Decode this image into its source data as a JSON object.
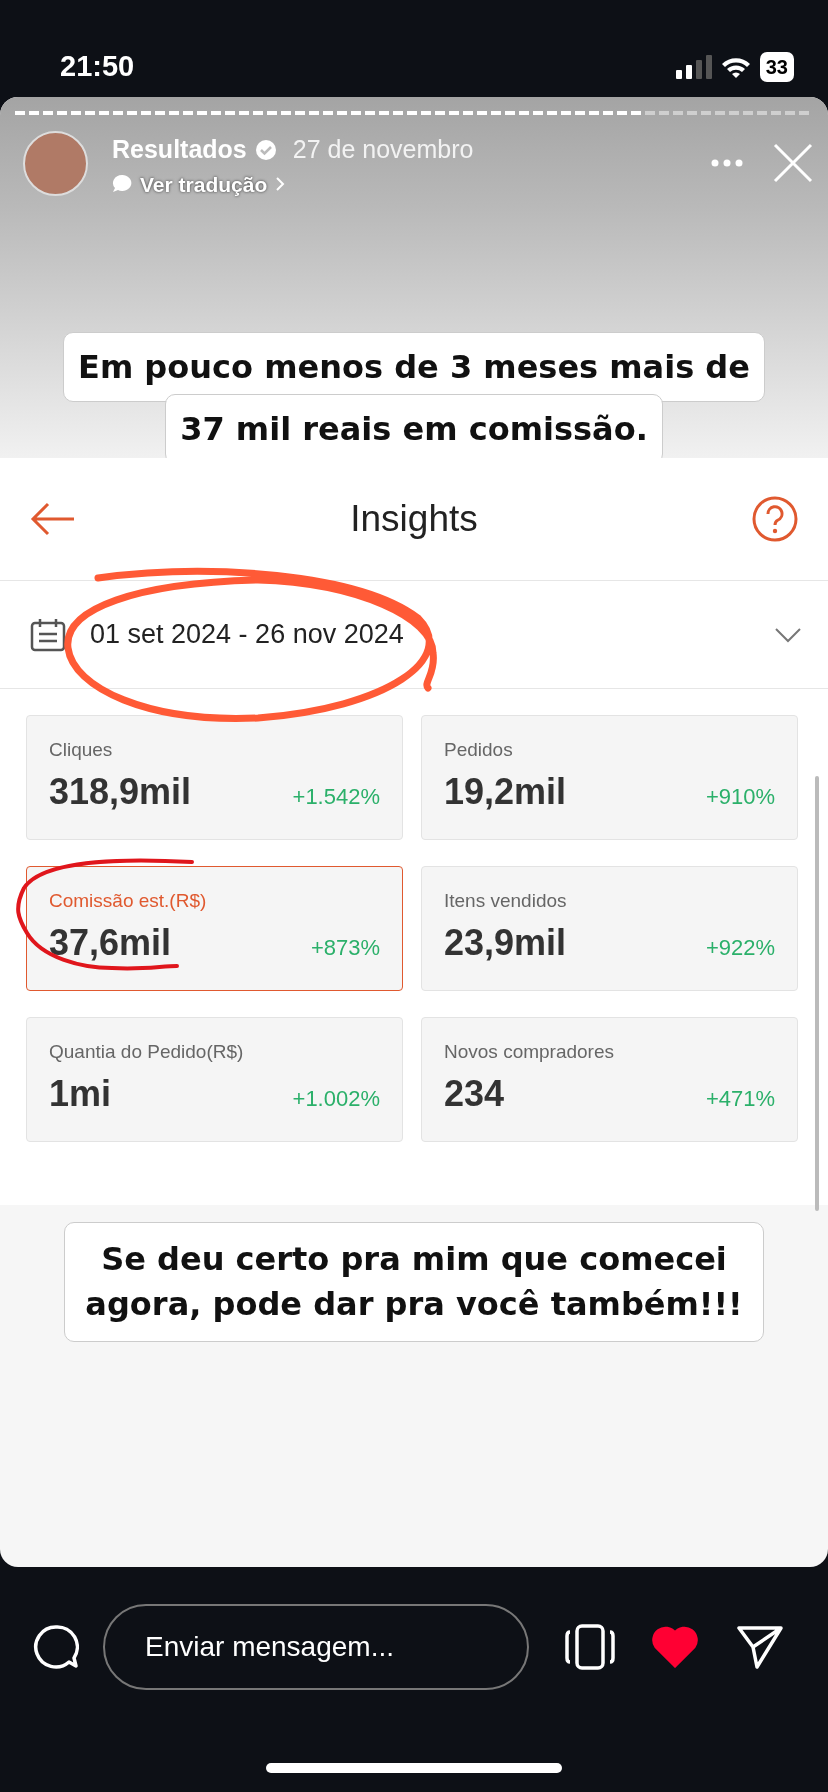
{
  "status_bar": {
    "time": "21:50",
    "battery": "33"
  },
  "story": {
    "progress": {
      "level": 0.79
    },
    "author": "Resultados",
    "date": "27 de novembro",
    "translate": "Ver tradução"
  },
  "top_caption": {
    "lines": [
      "Em pouco menos de 3 meses mais de",
      "37 mil reais em comissão."
    ]
  },
  "insights": {
    "title": "Insights",
    "date_range": "01 set 2024 - 26 nov 2024",
    "metrics": [
      {
        "label": "Cliques",
        "value": "318,9mil",
        "change": "+1.542%",
        "selected": false
      },
      {
        "label": "Pedidos",
        "value": "19,2mil",
        "change": "+910%",
        "selected": false
      },
      {
        "label": "Comissão est.(R$)",
        "value": "37,6mil",
        "change": "+873%",
        "selected": true
      },
      {
        "label": "Itens vendidos",
        "value": "23,9mil",
        "change": "+922%",
        "selected": false
      },
      {
        "label": "Quantia do Pedido(R$)",
        "value": "1mi",
        "change": "+1.002%",
        "selected": false
      },
      {
        "label": "Novos compradores",
        "value": "234",
        "change": "+471%",
        "selected": false
      }
    ]
  },
  "bottom_caption": {
    "lines": [
      "Se deu certo pra mim que comecei",
      "agora, pode dar pra você também!!!"
    ]
  },
  "reply_bar": {
    "placeholder": "Enviar mensagem...",
    "liked": true
  }
}
